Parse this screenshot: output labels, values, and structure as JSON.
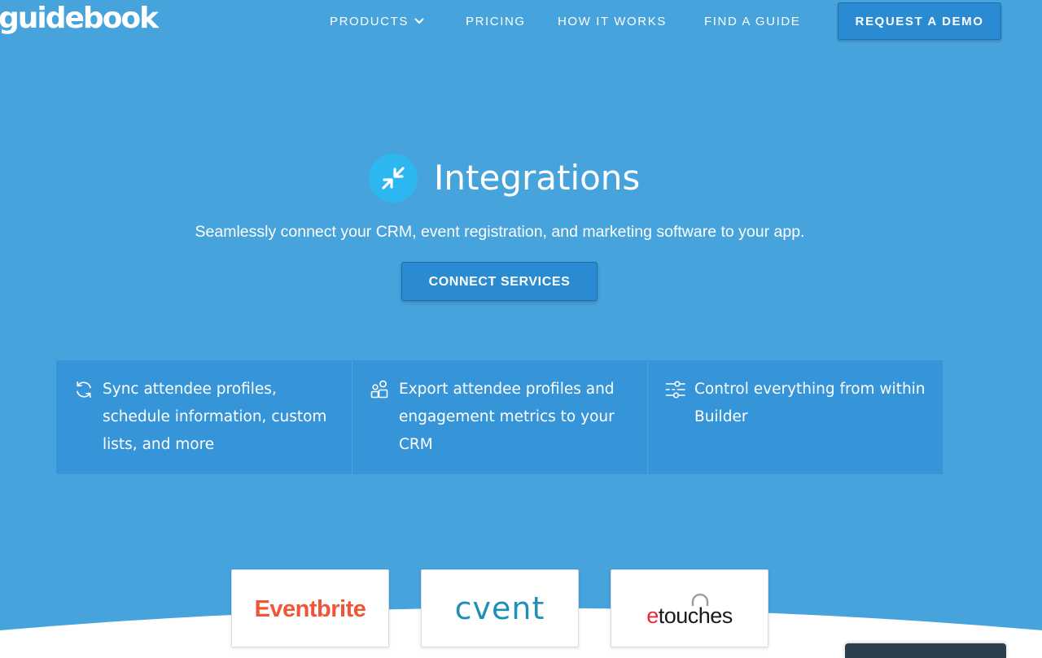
{
  "header": {
    "logo": "guidebook",
    "nav": {
      "products": "PRODUCTS",
      "pricing": "PRICING",
      "how_it_works": "HOW IT WORKS",
      "find_a_guide": "FIND A GUIDE"
    },
    "cta": "REQUEST A DEMO"
  },
  "hero": {
    "icon": "compress-arrows-icon",
    "title": "Integrations",
    "subtitle": "Seamlessly connect your CRM, event registration, and marketing software to your app.",
    "button": "CONNECT SERVICES"
  },
  "features": [
    {
      "icon": "sync-icon",
      "text": "Sync attendee profiles, schedule information, custom lists, and more"
    },
    {
      "icon": "people-icon",
      "text": "Export attendee profiles and engagement metrics to your CRM"
    },
    {
      "icon": "sliders-icon",
      "text": "Control everything from within Builder"
    }
  ],
  "partners": {
    "eventbrite": "Eventbrite",
    "cvent": "cvent",
    "etouches_accent": "e",
    "etouches_rest": "touches"
  },
  "colors": {
    "background": "#46a3dc",
    "button": "#2a8ad2",
    "feature_panel": "#3695d8",
    "icon_circle": "#2db7f0",
    "eventbrite": "#f05537",
    "cvent": "#1e8fb7",
    "etouches_red": "#e8293a"
  }
}
